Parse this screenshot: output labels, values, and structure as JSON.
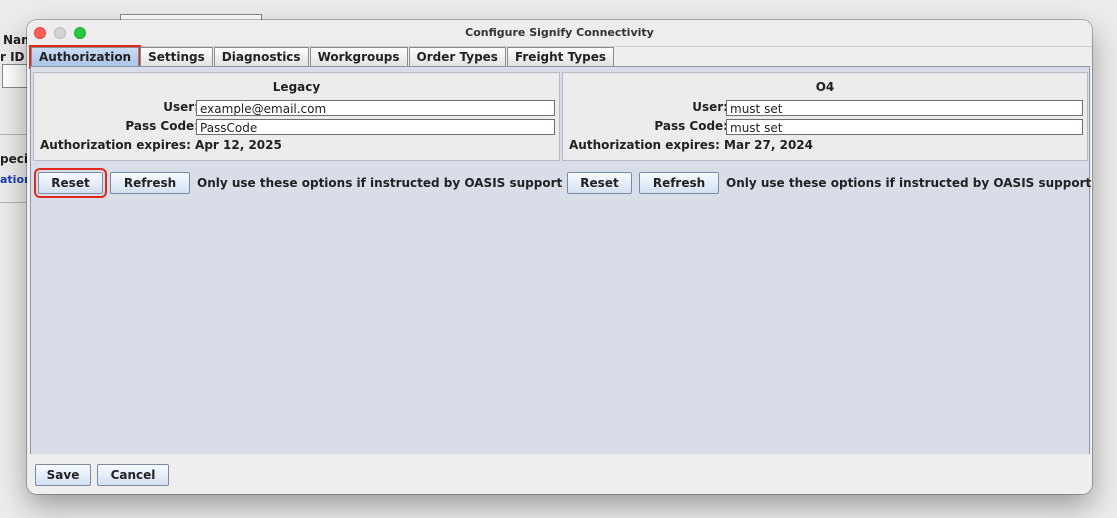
{
  "background": {
    "label_name": "Nam",
    "label_id": "r ID",
    "label_special": "peci",
    "link_text": "ation"
  },
  "dialog": {
    "title": "Configure Signify Connectivity",
    "tabs": [
      {
        "label": "Authorization",
        "active": true
      },
      {
        "label": "Settings",
        "active": false
      },
      {
        "label": "Diagnostics",
        "active": false
      },
      {
        "label": "Workgroups",
        "active": false
      },
      {
        "label": "Order Types",
        "active": false
      },
      {
        "label": "Freight Types",
        "active": false
      }
    ],
    "legacy": {
      "title": "Legacy",
      "user_label": "User:",
      "user_value": "example@email.com",
      "passcode_label": "Pass Code:",
      "passcode_value": "PassCode",
      "expires": "Authorization expires:  Apr 12, 2025"
    },
    "o4": {
      "title": "O4",
      "user_label": "User:",
      "user_value": "must set",
      "passcode_label": "Pass Code:",
      "passcode_value": "must set",
      "expires": "Authorization expires:  Mar 27, 2024"
    },
    "reset_label": "Reset",
    "refresh_label": "Refresh",
    "support_note": "Only use these options if instructed by OASIS support",
    "save_label": "Save",
    "cancel_label": "Cancel"
  },
  "colors": {
    "highlight": "#e0281e",
    "active_tab": "#b8cff0",
    "link": "#1b3bb5"
  }
}
